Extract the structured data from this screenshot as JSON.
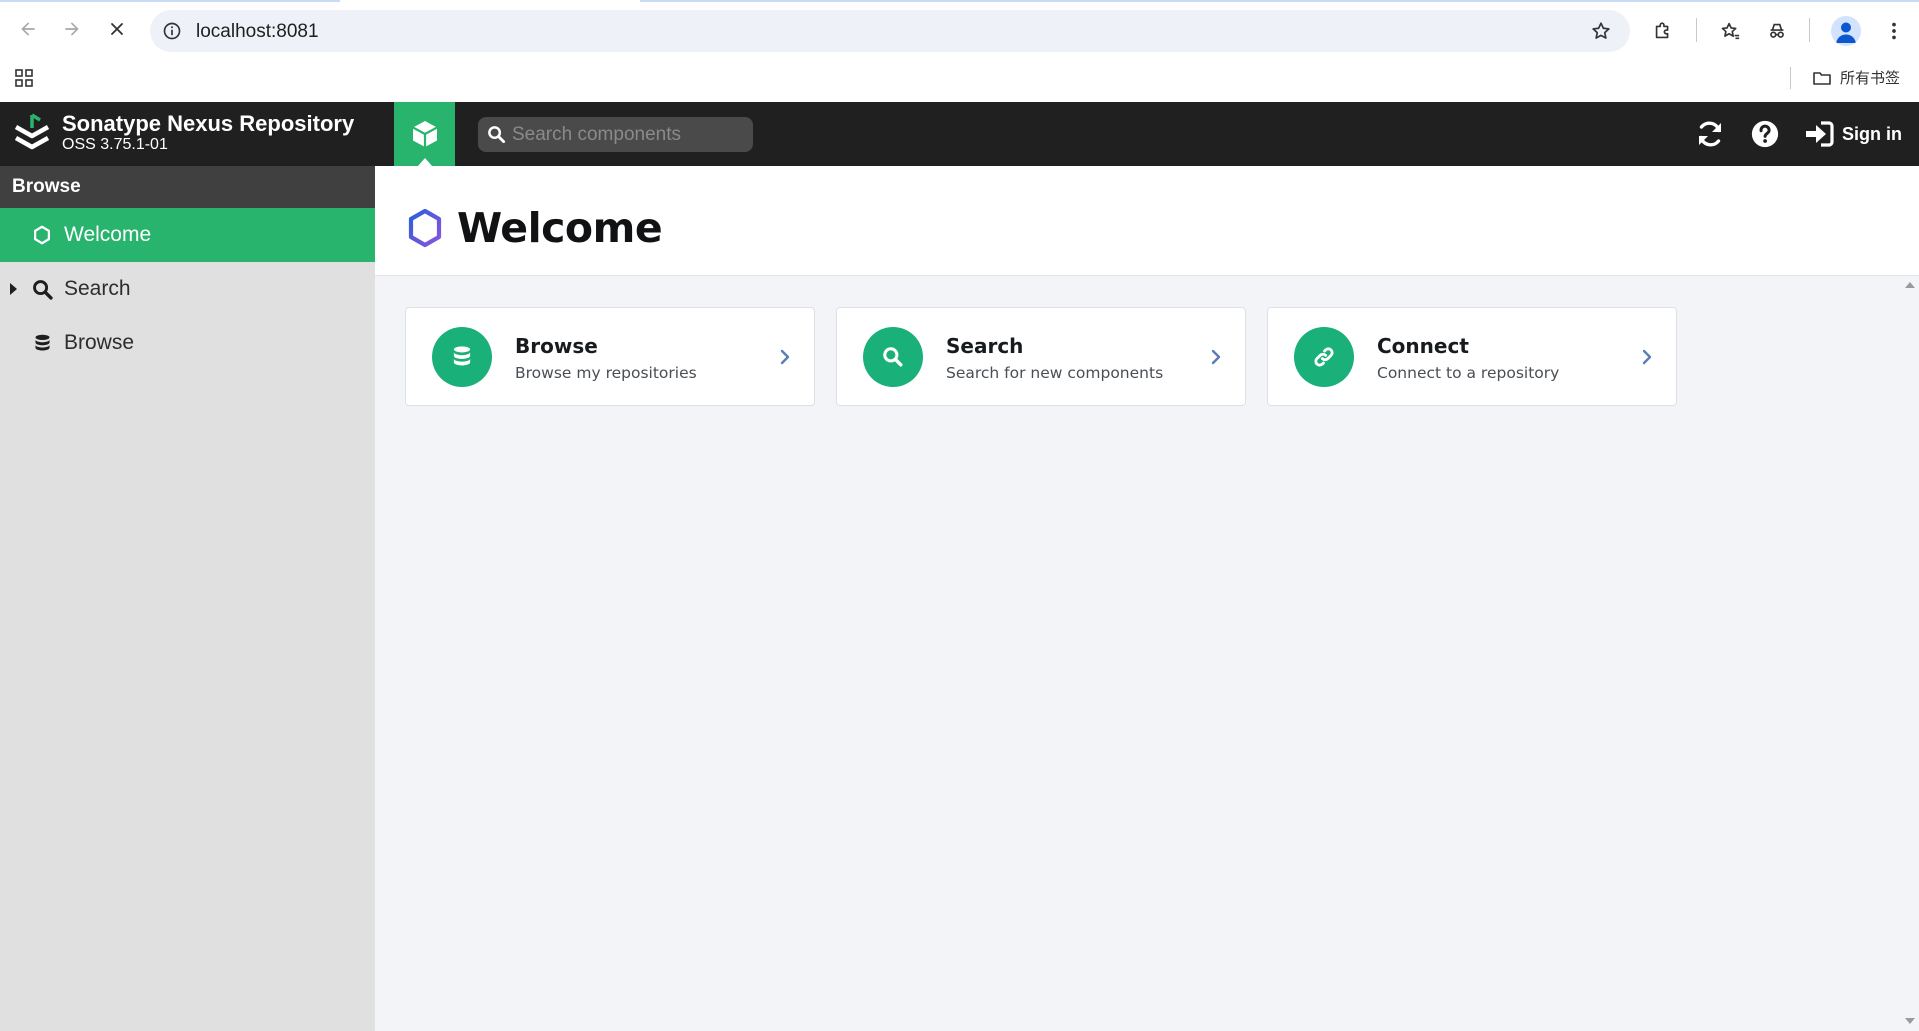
{
  "browser": {
    "url": "localhost:8081",
    "bookmarks_folder_label": "所有书签"
  },
  "header": {
    "product_name": "Sonatype Nexus Repository",
    "version": "OSS 3.75.1-01",
    "search_placeholder": "Search components",
    "sign_in_label": "Sign in"
  },
  "sidebar": {
    "section_title": "Browse",
    "items": [
      {
        "label": "Welcome",
        "icon": "hexagon-outline-icon",
        "active": true
      },
      {
        "label": "Search",
        "icon": "magnifier-icon",
        "expandable": true
      },
      {
        "label": "Browse",
        "icon": "database-icon"
      }
    ]
  },
  "main": {
    "page_title": "Welcome",
    "cards": [
      {
        "title": "Browse",
        "description": "Browse my repositories",
        "icon": "database-icon"
      },
      {
        "title": "Search",
        "description": "Search for new components",
        "icon": "magnifier-icon"
      },
      {
        "title": "Connect",
        "description": "Connect to a repository",
        "icon": "link-icon"
      }
    ]
  },
  "colors": {
    "accent_green": "#28b46d",
    "card_icon_green": "#1ab07a",
    "header_bg": "#202020",
    "sidebar_bg": "#e0e0e0",
    "main_bg": "#f3f4f7"
  }
}
